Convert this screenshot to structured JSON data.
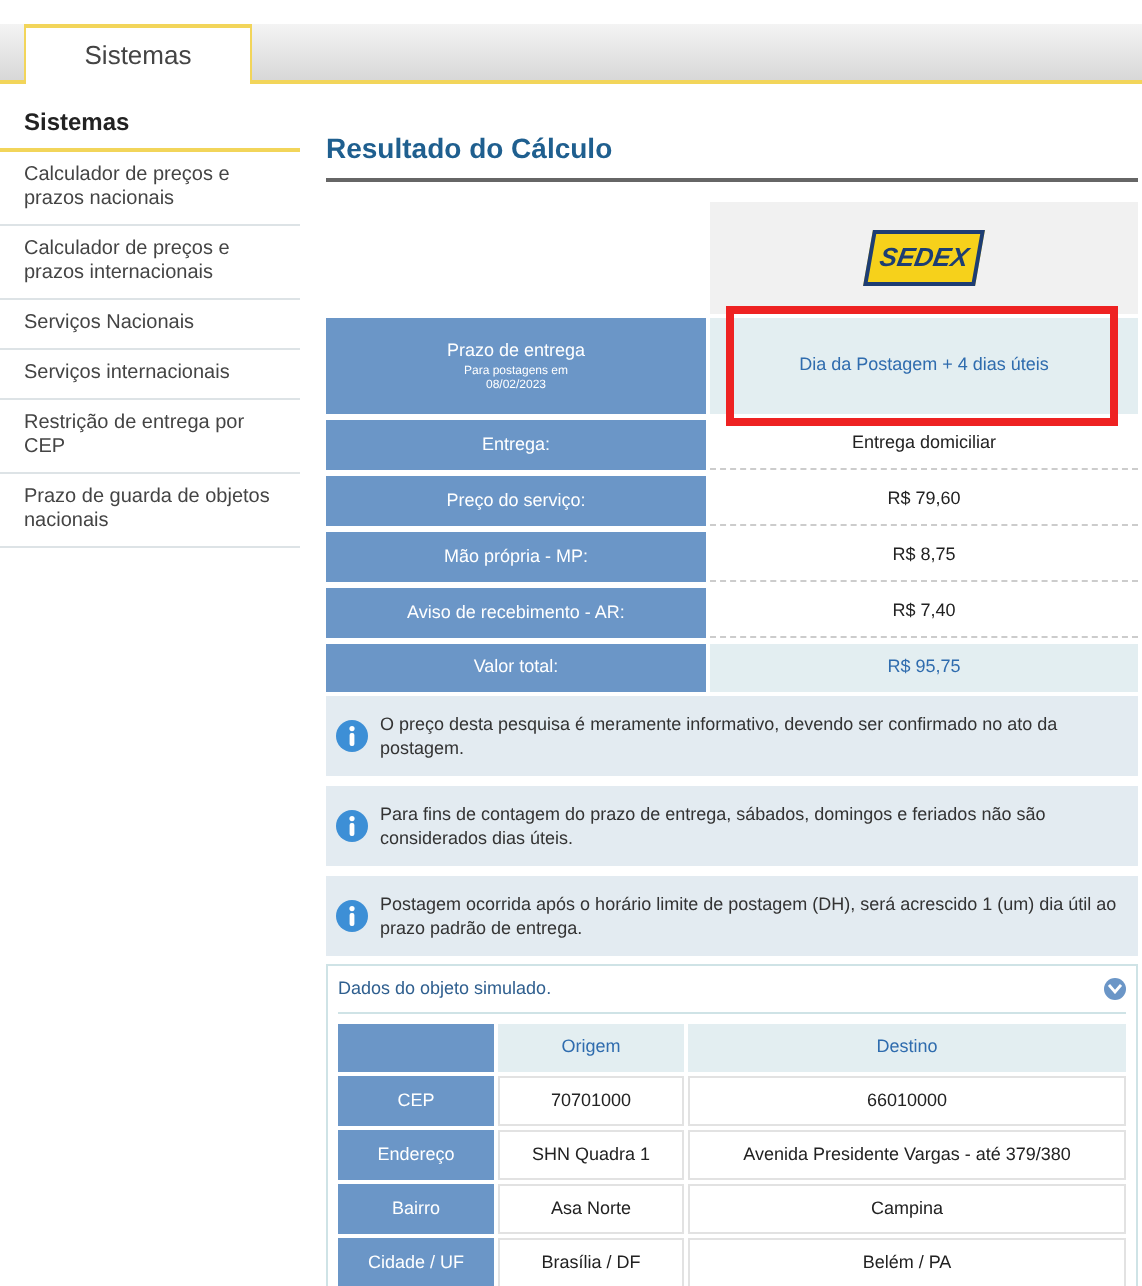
{
  "tabs": [
    {
      "label": "Sistemas",
      "selected": true
    }
  ],
  "sidebar": {
    "title": "Sistemas",
    "items": [
      "Calculador de preços e prazos nacionais",
      "Calculador de preços e prazos internacionais",
      "Serviços Nacionais",
      "Serviços internacionais",
      "Restrição de entrega por CEP",
      "Prazo de guarda de objetos nacionais"
    ]
  },
  "heading": "Resultado do Cálculo",
  "service": {
    "logo": "SEDEX"
  },
  "deadline": {
    "label": "Prazo de entrega",
    "sublabel": "Para postagens em",
    "date": "08/02/2023",
    "value": "Dia da Postagem + 4 dias úteis",
    "highlighted": true
  },
  "rows": [
    {
      "label": "Entrega:",
      "value": "Entrega domiciliar"
    },
    {
      "label": "Preço do serviço:",
      "value": "R$ 79,60"
    },
    {
      "label": "Mão própria - MP:",
      "value": "R$ 8,75"
    },
    {
      "label": "Aviso de recebimento - AR:",
      "value": "R$ 7,40"
    }
  ],
  "total": {
    "label": "Valor total:",
    "value": "R$ 95,75"
  },
  "notes": [
    "O preço desta pesquisa é meramente informativo, devendo ser confirmado no ato da postagem.",
    "Para fins de contagem do prazo de entrega, sábados, domingos e feriados não são considerados dias úteis.",
    "Postagem ocorrida após o horário limite de postagem (DH), será acrescido 1 (um) dia útil ao prazo padrão de entrega."
  ],
  "object_panel": {
    "title": "Dados do objeto simulado.",
    "expanded": true,
    "columns": [
      "Origem",
      "Destino"
    ],
    "rows": [
      {
        "label": "CEP",
        "origin": "70701000",
        "destination": "66010000"
      },
      {
        "label": "Endereço",
        "origin": "SHN Quadra 1",
        "destination": "Avenida Presidente Vargas - até 379/380"
      },
      {
        "label": "Bairro",
        "origin": "Asa Norte",
        "destination": "Campina"
      },
      {
        "label": "Cidade / UF",
        "origin": "Brasília / DF",
        "destination": "Belém / PA"
      }
    ]
  }
}
